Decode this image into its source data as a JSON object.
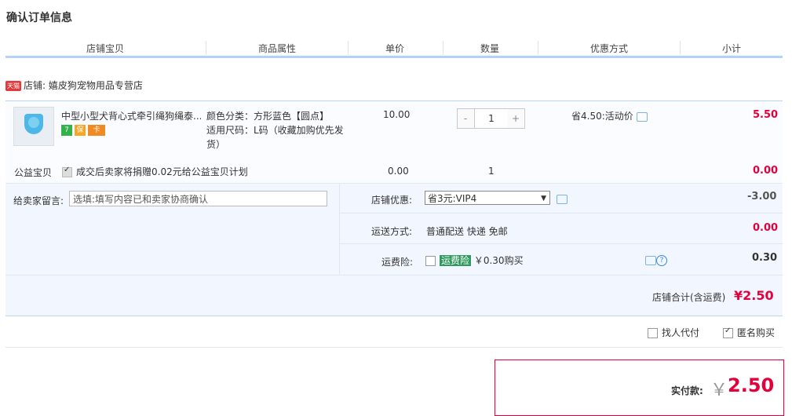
{
  "page": {
    "title": "确认订单信息"
  },
  "header": {
    "col_shop_item": "店铺宝贝",
    "col_attrs": "商品属性",
    "col_price": "单价",
    "col_qty": "数量",
    "col_discount": "优惠方式",
    "col_subtotal": "小计"
  },
  "shop": {
    "badge": "天猫",
    "label": "店铺: 嬉皮狗宠物用品专营店"
  },
  "item": {
    "name": "中型小型犬背心式牵引绳狗绳泰...",
    "attr_color": "颜色分类：方形蓝色【圆点】",
    "attr_size": "适用尺码：L码（收藏加购优先发货）",
    "unit_price": "10.00",
    "qty_minus": "-",
    "qty": "1",
    "qty_plus": "+",
    "discount": "省4.50:活动价",
    "subtotal": "5.50",
    "badges": [
      "7",
      "保",
      "卡"
    ]
  },
  "charity": {
    "label": "公益宝贝",
    "text": "成交后卖家将捐赠0.02元给公益宝贝计划",
    "price": "0.00",
    "qty": "1",
    "subtotal": "0.00"
  },
  "message": {
    "label": "给卖家留言:",
    "placeholder": "选填:填写内容已和卖家协商确认"
  },
  "shop_discount": {
    "label": "店铺优惠:",
    "selected": "省3元:VIP4",
    "amount": "-3.00"
  },
  "shipping": {
    "label": "运送方式:",
    "value": "普通配送 快递 免邮",
    "amount": "0.00"
  },
  "insurance": {
    "label": "运费险:",
    "tag": "运费险",
    "price": "￥0.30购买",
    "amount": "0.30"
  },
  "shop_total": {
    "label": "店铺合计(含运费)",
    "amount": "¥2.50"
  },
  "options": {
    "proxy_pay": "找人代付",
    "anonymous": "匿名购买"
  },
  "pay": {
    "label": "实付款:",
    "currency": "￥",
    "amount": "2.50"
  },
  "colors": {
    "accent_red": "#e4003a",
    "header_line": "#b2d1ff",
    "panel_bg": "#f2f7ff"
  }
}
